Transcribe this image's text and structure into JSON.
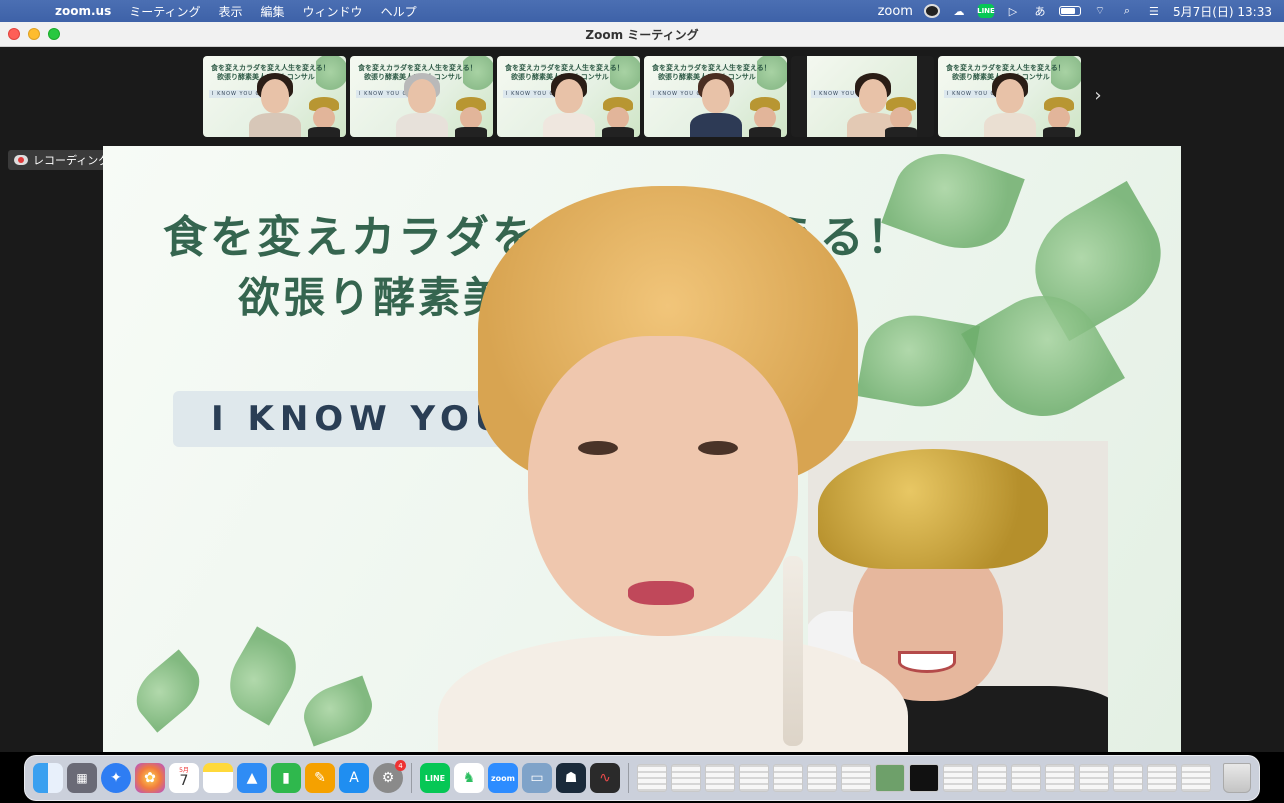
{
  "menubar": {
    "app_name": "zoom.us",
    "items": [
      "ミーティング",
      "表示",
      "編集",
      "ウィンドウ",
      "ヘルプ"
    ],
    "status_zoom": "zoom",
    "line_label": "LINE",
    "ime": "あ",
    "datetime": "5月7日(日)  13:33"
  },
  "window": {
    "title": "Zoom ミーティング"
  },
  "recording": {
    "label": "レコーディング..."
  },
  "thumbnails": {
    "line1": "食を変えカラダを変え人生を変える！",
    "line2": "欲張り酵素美人チームコンサル",
    "know": "I KNOW YOU CAN",
    "count": 6
  },
  "slide": {
    "line1": "食を変えカラダを　　　を変える！",
    "line2": "欲張り酵素美　　　　ンサル",
    "know": "I KNOW YOU"
  },
  "dock": {
    "calendar_month": "5月",
    "calendar_day": "7",
    "settings_badge": "4",
    "line_label": "LINE",
    "zoom_label": "zoom"
  },
  "colors": {
    "menubar": "#4064aa",
    "slide_text": "#35654f",
    "record": "#e03a3a"
  }
}
